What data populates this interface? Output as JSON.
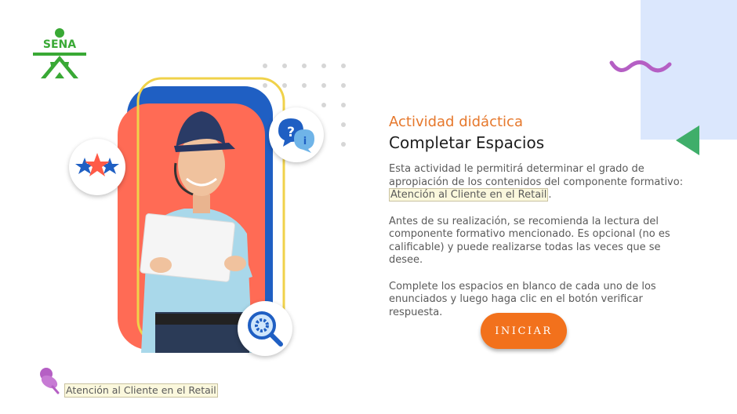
{
  "brand": {
    "logo_text": "SENA",
    "logo_color": "#39a935"
  },
  "content": {
    "kicker": "Actividad didáctica",
    "title": "Completar Espacios",
    "p1_text": "Esta actividad le permitirá determinar el grado de apropiación de los contenidos del componente formativo: ",
    "p1_highlight": "Atención al Cliente en el Retail",
    "p1_end": ".",
    "p2": "Antes de su realización, se recomienda la lectura del componente formativo mencionado.  Es opcional (no es calificable) y puede realizarse todas las veces que se desee.",
    "p3": "Complete los espacios en blanco de cada uno de los enunciados y luego haga clic en el botón verificar respuesta."
  },
  "start_button": {
    "label": "INICIAR"
  },
  "footer": {
    "component_name": "Atención al Cliente en el Retail"
  },
  "icons": [
    "sena-logo-icon",
    "stars-icon",
    "help-chat-icon",
    "magnifier-gear-icon",
    "pushpin-icon",
    "wave-icon",
    "triangle-arrow-icon"
  ],
  "colors": {
    "accent_orange": "#f2711c",
    "kicker_orange": "#e6782c",
    "green": "#3fae6a",
    "purple": "#b55fc4",
    "panel_blue": "#dbe7fd"
  }
}
